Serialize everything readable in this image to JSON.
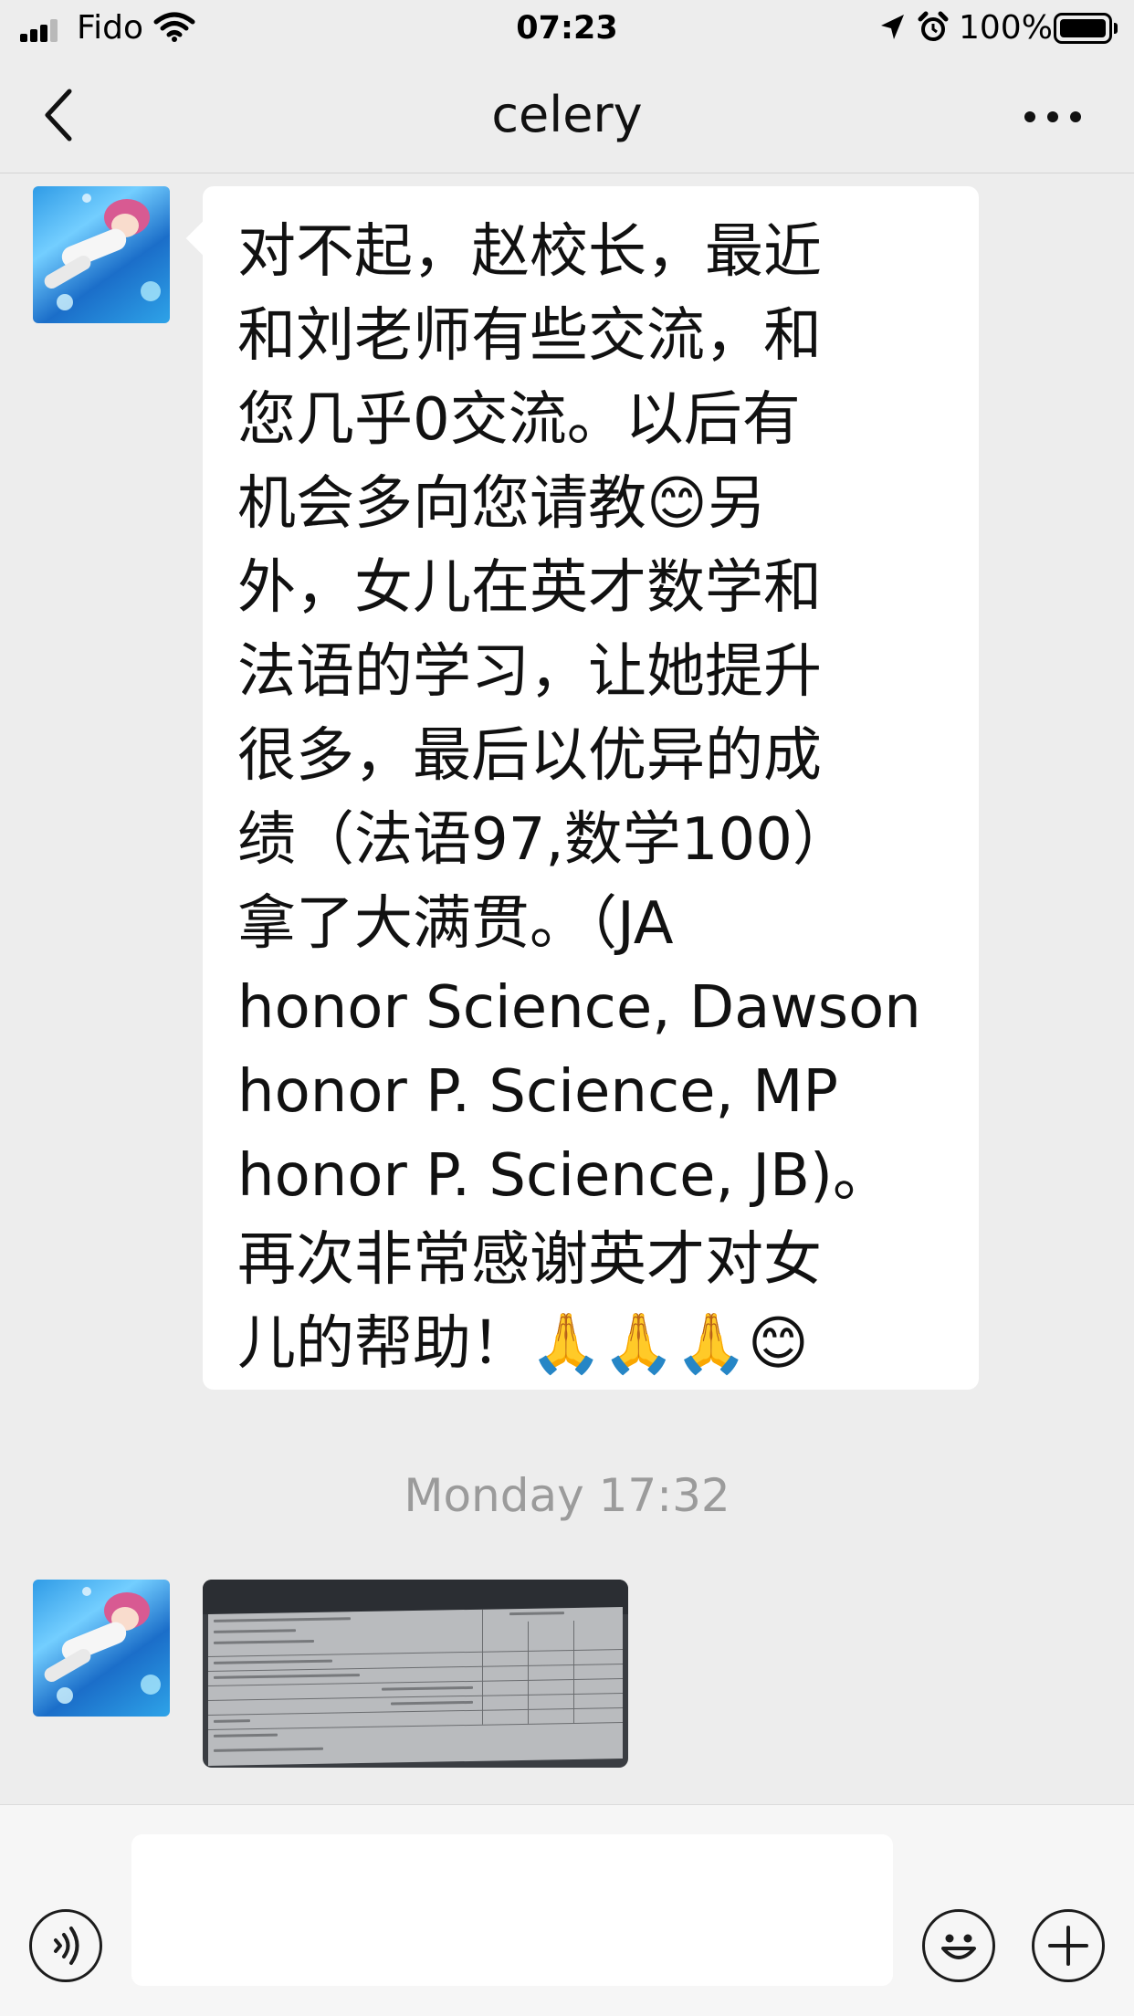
{
  "status_bar": {
    "carrier": "Fido",
    "time": "07:23",
    "battery": "100%",
    "battery_level": 1.0,
    "signal_bars": 3,
    "icons": [
      "signal-icon",
      "wifi-icon",
      "location-icon",
      "alarm-icon",
      "battery-icon"
    ]
  },
  "header": {
    "title": "celery",
    "back_icon": "chevron-left-icon",
    "more_icon": "more-dots-icon"
  },
  "messages": [
    {
      "type": "text",
      "text": "对不起，赵校长，最近\n和刘老师有些交流，和\n您几乎0交流。以后有\n机会多向您请教😊另\n外，女儿在英才数学和\n法语的学习，让她提升\n很多，最后以优异的成\n绩（法语97,数学100）\n拿了大满贯。（JA\nhonor Science, Dawson\nhonor P. Science, MP\nhonor P. Science, JB)。\n再次非常感谢英才对女\n儿的帮助！🙏🙏🙏😊"
    },
    {
      "type": "timestamp",
      "text": "Monday 17:32"
    },
    {
      "type": "image",
      "description_icon": "photo-thumbnail"
    }
  ],
  "input_bar": {
    "placeholder": "",
    "voice_icon": "voice-icon",
    "emoji_icon": "emoji-icon",
    "plus_icon": "plus-icon"
  },
  "colors": {
    "background": "#ededed",
    "bubble": "#ffffff",
    "timestamp": "#9b9b9b",
    "input_bar": "#f6f6f6"
  }
}
